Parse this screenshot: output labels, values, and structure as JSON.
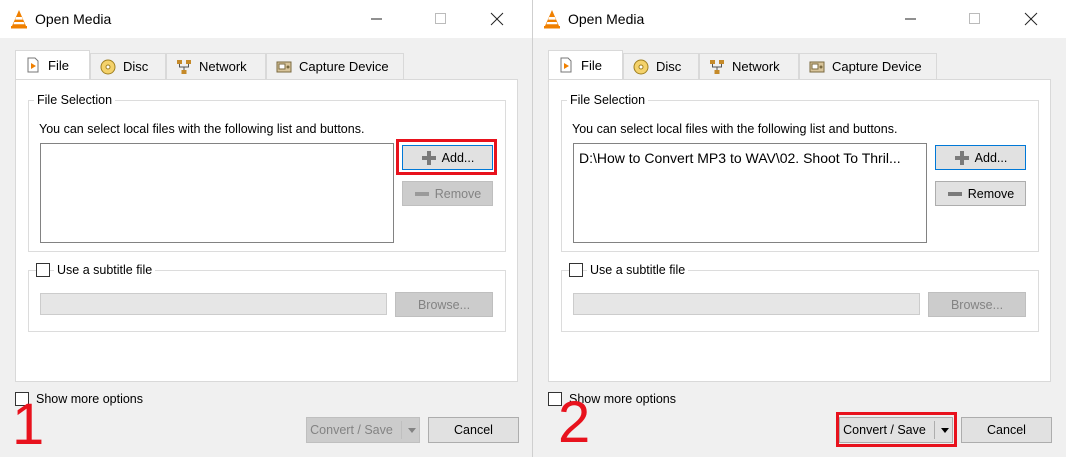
{
  "windows": [
    {
      "title": "Open Media",
      "tabs": [
        "File",
        "Disc",
        "Network",
        "Capture Device"
      ],
      "file_selection": {
        "group_label": "File Selection",
        "instructions": "You can select local files with the following list and buttons.",
        "files": [],
        "add_label": "Add...",
        "remove_label": "Remove"
      },
      "subtitle": {
        "label": "Use a subtitle file",
        "browse_label": "Browse..."
      },
      "show_more": "Show more options",
      "convert_label": "Convert / Save",
      "cancel_label": "Cancel",
      "step_number": "1",
      "highlight": "add-button"
    },
    {
      "title": "Open Media",
      "tabs": [
        "File",
        "Disc",
        "Network",
        "Capture Device"
      ],
      "file_selection": {
        "group_label": "File Selection",
        "instructions": "You can select local files with the following list and buttons.",
        "files": [
          "D:\\How to Convert MP3 to WAV\\02. Shoot To Thril..."
        ],
        "add_label": "Add...",
        "remove_label": "Remove"
      },
      "subtitle": {
        "label": "Use a subtitle file",
        "browse_label": "Browse..."
      },
      "show_more": "Show more options",
      "convert_label": "Convert / Save",
      "cancel_label": "Cancel",
      "step_number": "2",
      "highlight": "convert-save-button"
    }
  ],
  "colors": {
    "highlight": "#e8121d",
    "accent": "#0078d7",
    "vlc_orange": "#f08000"
  }
}
